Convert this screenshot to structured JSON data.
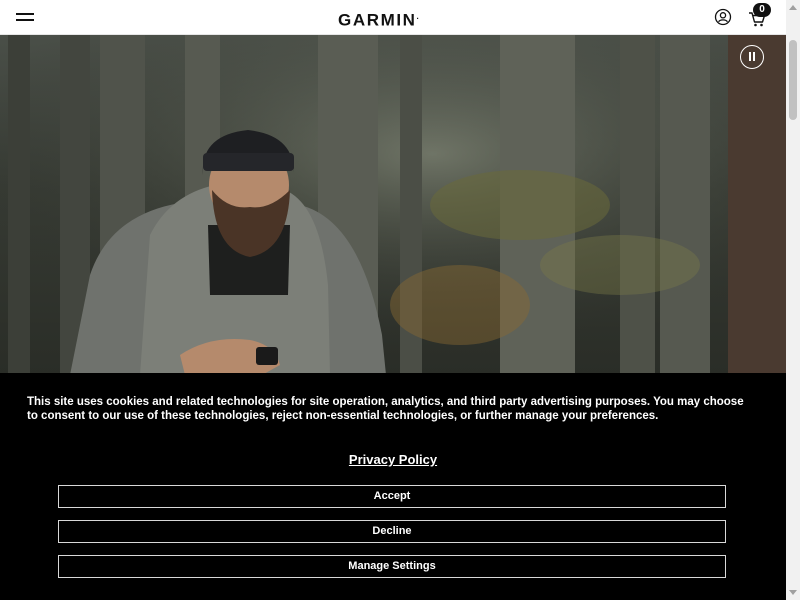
{
  "header": {
    "logo_text": "GARMIN",
    "logo_mark": ".",
    "cart_count": "0"
  },
  "hero": {
    "image_description_icon": "pause-icon"
  },
  "cookie_banner": {
    "text": "This site uses cookies and related technologies for site operation, analytics, and third party advertising purposes. You may choose to consent to our use of these technologies, reject non-essential technologies, or further manage your preferences.",
    "privacy_link": "Privacy Policy",
    "accept_label": "Accept",
    "decline_label": "Decline",
    "manage_label": "Manage Settings"
  },
  "colors": {
    "banner_bg": "#000000",
    "header_bg": "#ffffff"
  }
}
